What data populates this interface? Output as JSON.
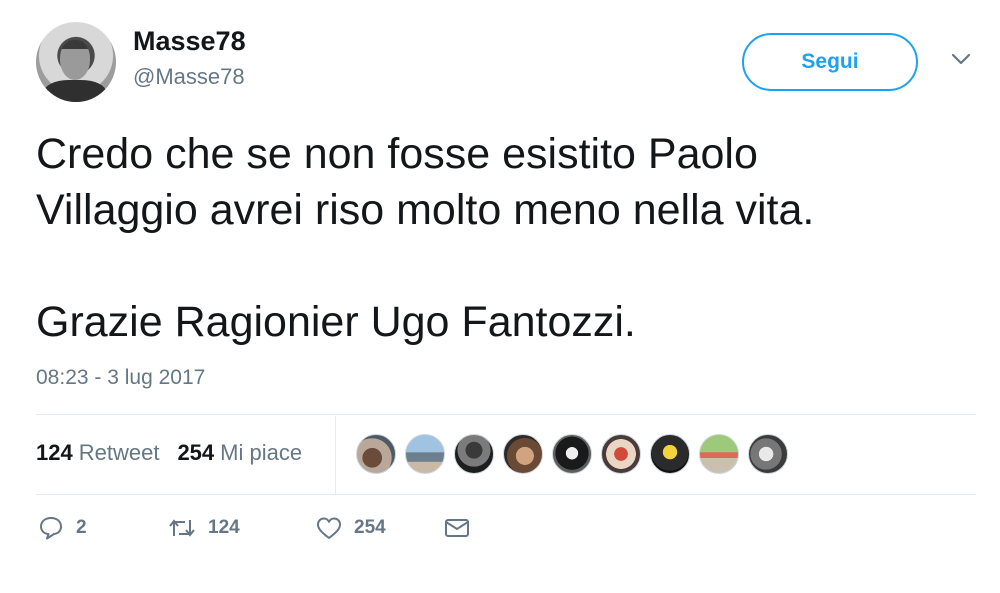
{
  "author": {
    "display_name": "Masse78",
    "handle": "@Masse78"
  },
  "follow_button": {
    "label": "Segui"
  },
  "tweet": {
    "lines": [
      "Credo che se non fosse esistito Paolo",
      "Villaggio avrei riso molto meno nella vita.",
      "",
      "Grazie Ragionier Ugo Fantozzi."
    ],
    "timestamp": "08:23 - 3 lug 2017"
  },
  "stats": {
    "retweets_count": "124",
    "retweets_label": "Retweet",
    "likes_count": "254",
    "likes_label": "Mi piace"
  },
  "actions": {
    "reply_count": "2",
    "retweet_count": "124",
    "like_count": "254"
  },
  "icons": {
    "reply": "reply-icon",
    "retweet": "retweet-icon",
    "like": "heart-icon",
    "dm": "envelope-icon",
    "menu": "chevron-down-icon"
  },
  "colors": {
    "accent": "#1da1f2",
    "secondary_text": "#657786",
    "divider": "#e6ecf0"
  }
}
